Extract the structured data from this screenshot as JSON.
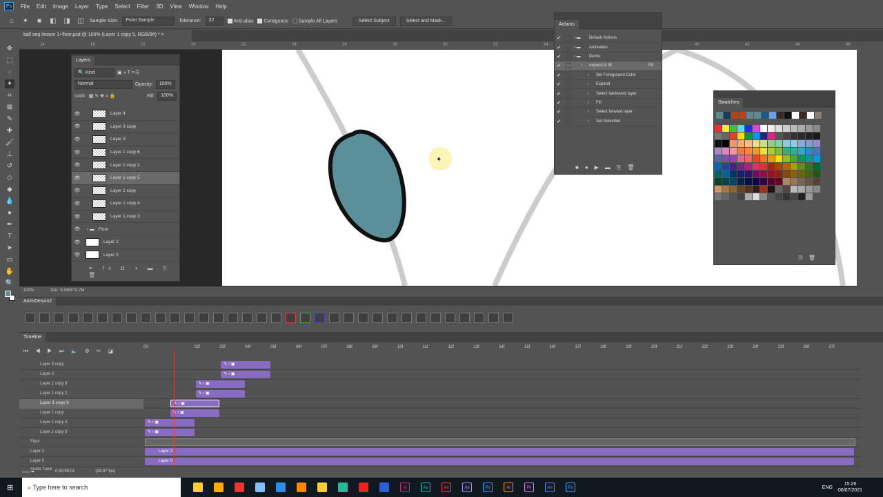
{
  "menu": {
    "items": [
      "File",
      "Edit",
      "Image",
      "Layer",
      "Type",
      "Select",
      "Filter",
      "3D",
      "View",
      "Window",
      "Help"
    ]
  },
  "options": {
    "sample_size_label": "Sample Size:",
    "sample_size": "Point Sample",
    "tolerance_label": "Tolerance:",
    "tolerance": "32",
    "anti_alias": "Anti-alias",
    "contiguous": "Contiguous",
    "sample_all": "Sample All Layers",
    "select_subject": "Select Subject",
    "select_mask": "Select and Mask..."
  },
  "document": {
    "tab": "ball seq lesson 1+floor.psd @ 100% (Layer 1 copy 5, RGB/8#) *",
    "zoom": "100%",
    "doc_size": "Doc: 5.93M/74.7M",
    "ruler": [
      "14",
      "16",
      "18",
      "20",
      "22",
      "24",
      "26",
      "28",
      "30",
      "32",
      "34",
      "36",
      "38",
      "40",
      "42",
      "44",
      "46"
    ]
  },
  "layers": {
    "title": "Layers",
    "kind": "Kind",
    "blend": "Normal",
    "opacity_label": "Opacity:",
    "opacity": "100%",
    "lock_label": "Lock:",
    "fill_label": "Fill:",
    "fill": "100%",
    "items": [
      {
        "name": "Layer 4"
      },
      {
        "name": "Layer 3 copy"
      },
      {
        "name": "Layer 3"
      },
      {
        "name": "Layer 1 copy 6"
      },
      {
        "name": "Layer 1 copy 2"
      },
      {
        "name": "Layer 1 copy 5",
        "selected": true
      },
      {
        "name": "Layer 1 copy"
      },
      {
        "name": "Layer 1 copy 4"
      },
      {
        "name": "Layer 1 copy 3"
      },
      {
        "name": "Floor",
        "group": true
      },
      {
        "name": "Layer 2"
      },
      {
        "name": "Layer 0"
      }
    ]
  },
  "actions": {
    "title": "Actions",
    "items": [
      {
        "label": "Default Actions",
        "level": 0,
        "folder": true
      },
      {
        "label": "Animation",
        "level": 0,
        "folder": true
      },
      {
        "label": "Demo",
        "level": 0,
        "folder": true
      },
      {
        "label": "expand & fill",
        "level": 1,
        "key": "F8"
      },
      {
        "label": "Set Foreground Color",
        "level": 2
      },
      {
        "label": "Expand",
        "level": 2
      },
      {
        "label": "Select backward layer",
        "level": 2
      },
      {
        "label": "Fill",
        "level": 2
      },
      {
        "label": "Select forward layer",
        "level": 2
      },
      {
        "label": "Set Selection",
        "level": 2
      }
    ]
  },
  "swatches": {
    "title": "Swatches",
    "recent": [
      "#5b8a94",
      "#1a3c5e",
      "#b5441c",
      "#b5441c",
      "#5b8a94",
      "#5b8a94",
      "#1d5a80",
      "#6aa0e8",
      "#3a2a26",
      "#111111",
      "#ffffff",
      "#3d2a26",
      "#ffffff",
      "#8a7c7c"
    ],
    "grid": [
      "#e8322a",
      "#f5ee20",
      "#45c233",
      "#55ddee",
      "#2233dd",
      "#dd44dd",
      "#ffffff",
      "#eeeeee",
      "#dddddd",
      "#cccccc",
      "#bbbbbb",
      "#aaaaaa",
      "#999999",
      "#888888",
      "#777777",
      "#666666",
      "#dd4422",
      "#ffdd00",
      "#009944",
      "#0099ee",
      "#222288",
      "#dd2288",
      "#555555",
      "#444444",
      "#333333",
      "#2a2a2a",
      "#222222",
      "#1a1a1a",
      "#111111",
      "#000000",
      "#ee9966",
      "#f4aa77",
      "#f7bb88",
      "#eedd88",
      "#ccdd88",
      "#99cc88",
      "#88ccaa",
      "#88ccdd",
      "#88ccee",
      "#88aadd",
      "#8899cc",
      "#9988cc",
      "#aa88cc",
      "#dd88bb",
      "#ee9999",
      "#ee7755",
      "#ee8844",
      "#ee9933",
      "#eedd44",
      "#aacc44",
      "#77bb55",
      "#44aa77",
      "#33aaaa",
      "#33aacc",
      "#3388cc",
      "#4477bb",
      "#5566aa",
      "#7755aa",
      "#9944aa",
      "#dd6699",
      "#ee6666",
      "#ee4422",
      "#ee7722",
      "#ee9900",
      "#ffdd00",
      "#99bb22",
      "#44aa33",
      "#009955",
      "#009999",
      "#0099dd",
      "#0066bb",
      "#224499",
      "#442288",
      "#772288",
      "#aa2288",
      "#dd3366",
      "#dd3333",
      "#aa2211",
      "#aa4411",
      "#aa6611",
      "#aa9911",
      "#668822",
      "#337722",
      "#006633",
      "#006666",
      "#006699",
      "#003366",
      "#112266",
      "#331166",
      "#661166",
      "#881144",
      "#991122",
      "#882211",
      "#884411",
      "#886611",
      "#666611",
      "#446611",
      "#225511",
      "#004422",
      "#004444",
      "#004466",
      "#002244",
      "#001144",
      "#110044",
      "#330044",
      "#550033",
      "#660022",
      "#aa8866",
      "#997755",
      "#776655",
      "#665544",
      "#554433",
      "#cc9966",
      "#aa7744",
      "#886633",
      "#664422",
      "#553322",
      "#332211",
      "#993311",
      "#221111",
      "#666666",
      "#554444",
      "#bbbbbb",
      "#aaaaaa",
      "#999999",
      "#888888",
      "#777777",
      "#666666",
      "#555555",
      "#444444",
      "#aaaaaa",
      "#dddddd",
      "#888888",
      "#555555",
      "#444444",
      "#333333",
      "#444444",
      "#222222",
      "#999999"
    ]
  },
  "anim_panel": {
    "title": "AnimDessin2"
  },
  "timeline": {
    "title": "Timeline",
    "timecode": "0;00;00;01",
    "fps": "(29.97 fps)",
    "audio": "Audio Track",
    "frames": [
      "00",
      "",
      "02f",
      "03f",
      "04f",
      "05f",
      "06f",
      "07f",
      "08f",
      "09f",
      "10f",
      "11f",
      "12f",
      "13f",
      "14f",
      "15f",
      "16f",
      "17f",
      "18f",
      "19f",
      "20f",
      "21f",
      "22f",
      "23f",
      "24f",
      "25f",
      "26f",
      "27f"
    ],
    "current_frame": 1,
    "tracks": [
      {
        "name": "Layer 3 copy",
        "start": 3,
        "end": 5
      },
      {
        "name": "Layer 3",
        "start": 3,
        "end": 5
      },
      {
        "name": "Layer 1 copy 6",
        "start": 2,
        "end": 4
      },
      {
        "name": "Layer 1 copy 2",
        "start": 2,
        "end": 4
      },
      {
        "name": "Layer 1 copy 5",
        "start": 1,
        "end": 3,
        "selected": true
      },
      {
        "name": "Layer 1 copy",
        "start": 1,
        "end": 3
      },
      {
        "name": "Layer 1 copy 4",
        "start": 0,
        "end": 2
      },
      {
        "name": "Layer 1 copy 3",
        "start": 0,
        "end": 2
      },
      {
        "name": "Floor",
        "group": true
      },
      {
        "name": "Layer 2",
        "start": 0,
        "end": 28,
        "label": "Layer 2"
      },
      {
        "name": "Layer 0",
        "start": 0,
        "end": 28,
        "label": "Layer 0"
      }
    ]
  },
  "taskbar": {
    "search": "Type here to search",
    "apps": [
      "Id",
      "Au",
      "An",
      "Ae",
      "Ps",
      "Ai",
      "Pr",
      "An",
      "Ps"
    ],
    "lang": "ENG",
    "time": "15:26",
    "date": "06/07/2021"
  },
  "colors": {
    "ball": "#5b9099",
    "clip": "#8a6bc2",
    "accent": "#31a8ff"
  }
}
